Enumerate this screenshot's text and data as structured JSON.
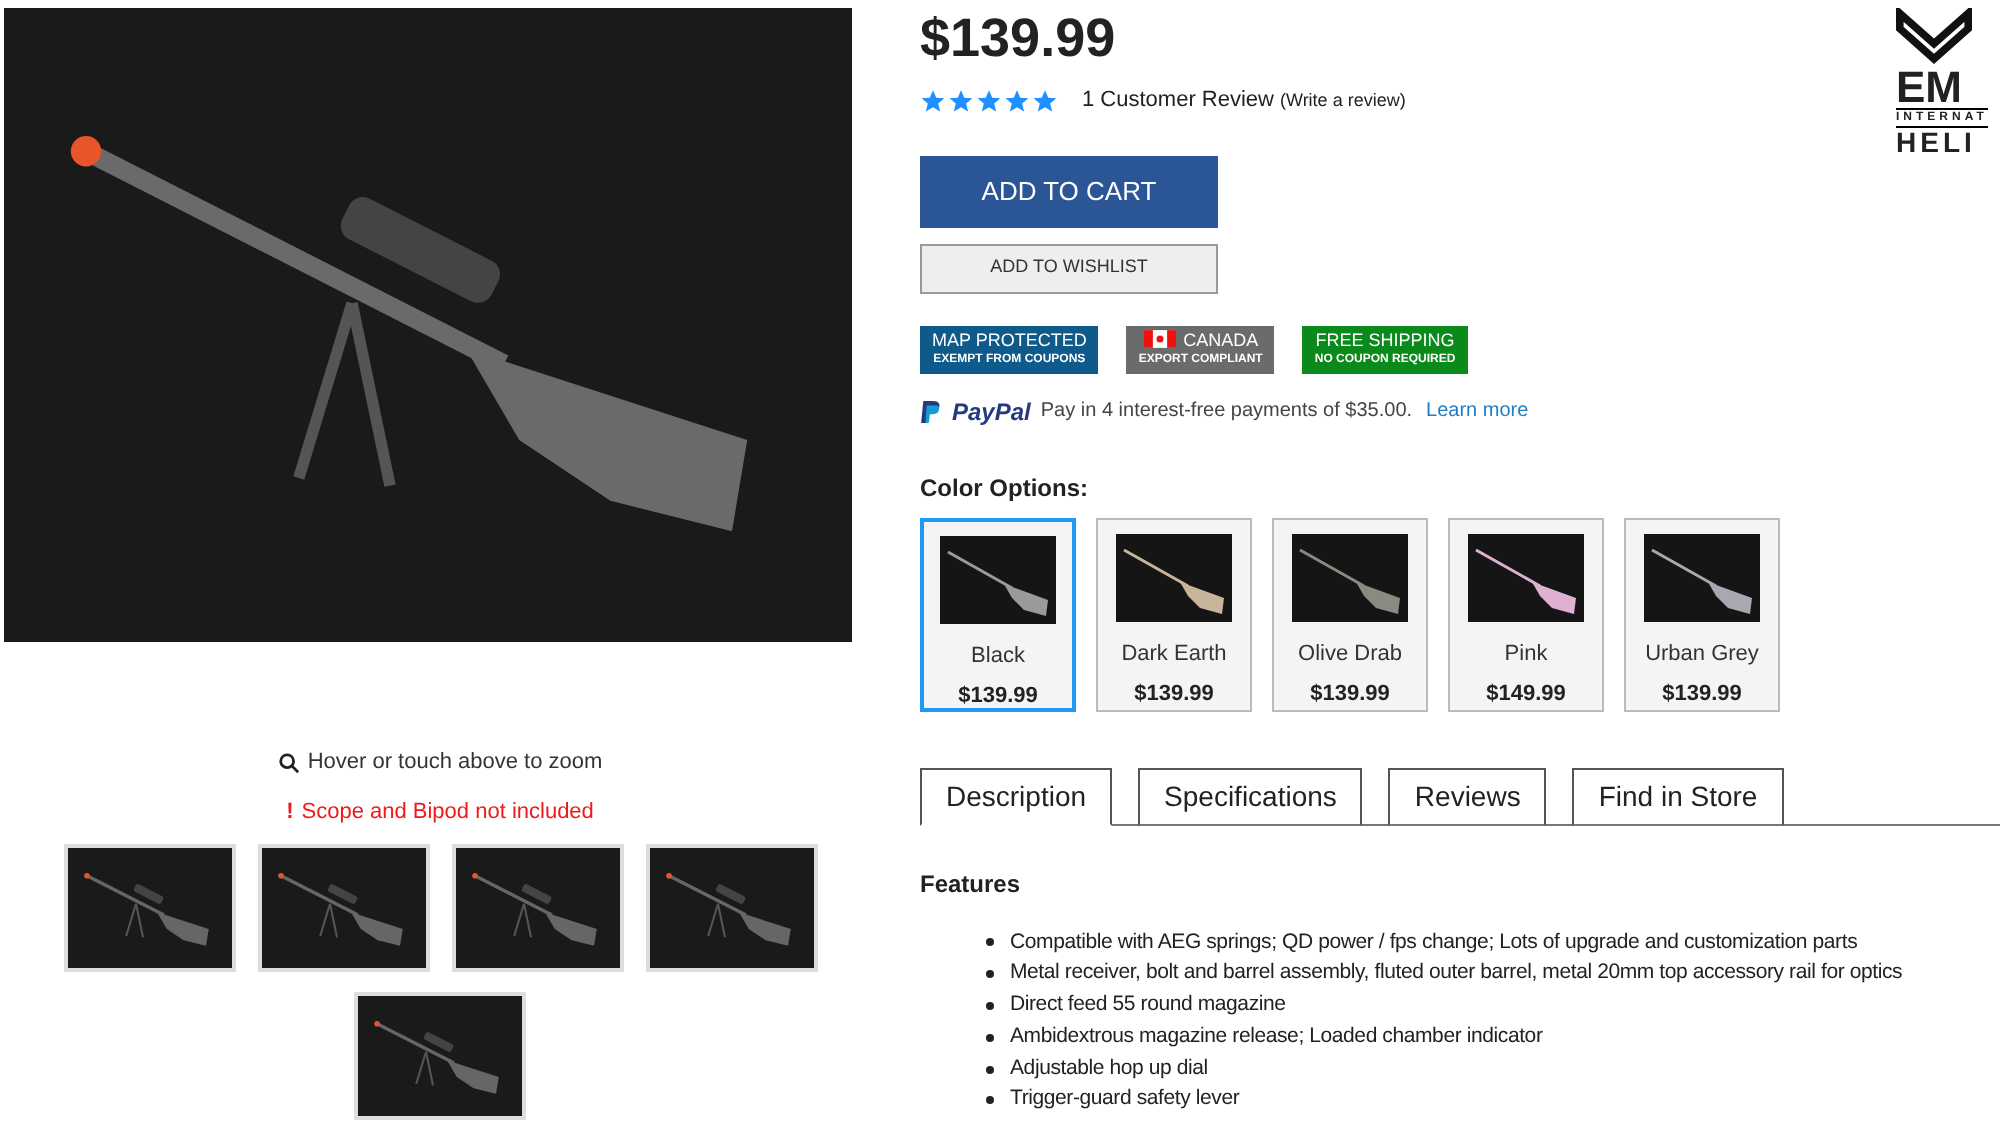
{
  "gallery": {
    "zoom_hint": "Hover or touch above to zoom",
    "warning_mark": "!",
    "warning": "Scope and Bipod not included",
    "thumbnails": [
      {
        "selected": false
      },
      {
        "selected": false
      },
      {
        "selected": false
      },
      {
        "selected": false
      },
      {
        "selected": false
      }
    ]
  },
  "product": {
    "price": "$139.99",
    "stars": 5,
    "review_count": "1 Customer Review",
    "write_review": "(Write a review)"
  },
  "logo": {
    "line_1": "EM",
    "line_2": "INTERNAT",
    "line_3": "HELI"
  },
  "buttons": {
    "add_to_cart": "ADD TO CART",
    "add_to_wishlist": "ADD TO WISHLIST"
  },
  "badges": [
    {
      "kind": "plain",
      "title": "MAP PROTECTED",
      "subtitle": "EXEMPT FROM COUPONS",
      "color": "#0e5a8a"
    },
    {
      "kind": "flag",
      "title": "CANADA",
      "subtitle": "EXPORT COMPLIANT",
      "color": "#6b6b6b"
    },
    {
      "kind": "plain",
      "title": "FREE SHIPPING",
      "subtitle": "NO COUPON REQUIRED",
      "color": "#0a8a1a"
    }
  ],
  "paypal": {
    "brand": "PayPal",
    "message": "Pay in 4 interest-free payments of $35.00.",
    "link": "Learn more"
  },
  "color_options": {
    "label": "Color Options:",
    "options": [
      {
        "name": "Black",
        "price": "$139.99",
        "selected": true,
        "color": "#9a9a9a"
      },
      {
        "name": "Dark Earth",
        "price": "$139.99",
        "selected": false,
        "color": "#c8b49a"
      },
      {
        "name": "Olive Drab",
        "price": "$139.99",
        "selected": false,
        "color": "#8a8a80"
      },
      {
        "name": "Pink",
        "price": "$149.99",
        "selected": false,
        "color": "#e0b0d0"
      },
      {
        "name": "Urban Grey",
        "price": "$139.99",
        "selected": false,
        "color": "#a8a8b0"
      }
    ]
  },
  "tabs": [
    {
      "label": "Description",
      "selected": true
    },
    {
      "label": "Specifications",
      "selected": false
    },
    {
      "label": "Reviews",
      "selected": false
    },
    {
      "label": "Find in Store",
      "selected": false
    }
  ],
  "description": {
    "heading": "Features",
    "features": [
      "Compatible with AEG springs; QD power / fps change; Lots of upgrade and customization parts",
      "Metal receiver, bolt and barrel assembly, fluted outer barrel, metal 20mm top accessory rail for optics",
      "Direct feed 55 round magazine",
      "Ambidextrous magazine release; Loaded chamber indicator",
      "Adjustable hop up dial",
      "Trigger-guard safety lever"
    ]
  }
}
